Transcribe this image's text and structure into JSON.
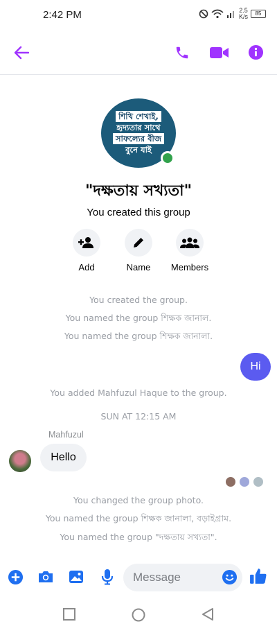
{
  "status": {
    "time": "2:42 PM",
    "speed_value": "2.5",
    "speed_unit": "K/s",
    "battery": "85"
  },
  "header": {
    "icons": [
      "back-arrow-icon",
      "phone-icon",
      "video-camera-icon",
      "info-icon"
    ],
    "accent": "#a033ff"
  },
  "group": {
    "photo_lines": [
      "শিখি শেখাই,",
      "হৃদ্যতার সাথে",
      "সাফল্যের বীজ",
      "বুনে যাই"
    ],
    "title": "\"দক্ষতায় সখ্যতা\"",
    "subtitle": "You created this group"
  },
  "actions": [
    {
      "label": "Add",
      "icon": "add-person-icon"
    },
    {
      "label": "Name",
      "icon": "pencil-icon"
    },
    {
      "label": "Members",
      "icon": "members-icon"
    }
  ],
  "messages": {
    "sys1": "You created the group.",
    "sys2": "You named the group শিক্ষক জানাল.",
    "sys3": "You named the group শিক্ষক জানালা.",
    "me_text": "Hi",
    "sys4": "You added Mahfuzul Haque to the group.",
    "timestamp": "SUN AT 12:15 AM",
    "sender_name": "Mahfuzul",
    "them_text": "Hello",
    "sys5": "You changed the group photo.",
    "sys6": "You named the group শিক্ষক জানালা, বড়াইগ্রাম.",
    "sys7": "You named the group \"দক্ষতায় সখ্যতা\"."
  },
  "composer": {
    "placeholder": "Message",
    "icons": [
      "plus-icon",
      "camera-icon",
      "gallery-icon",
      "microphone-icon",
      "emoji-icon",
      "thumbs-up-icon"
    ],
    "accent": "#1f6ff0"
  },
  "navigation": {
    "icons": [
      "recents-square-icon",
      "home-circle-icon",
      "back-triangle-icon"
    ]
  }
}
